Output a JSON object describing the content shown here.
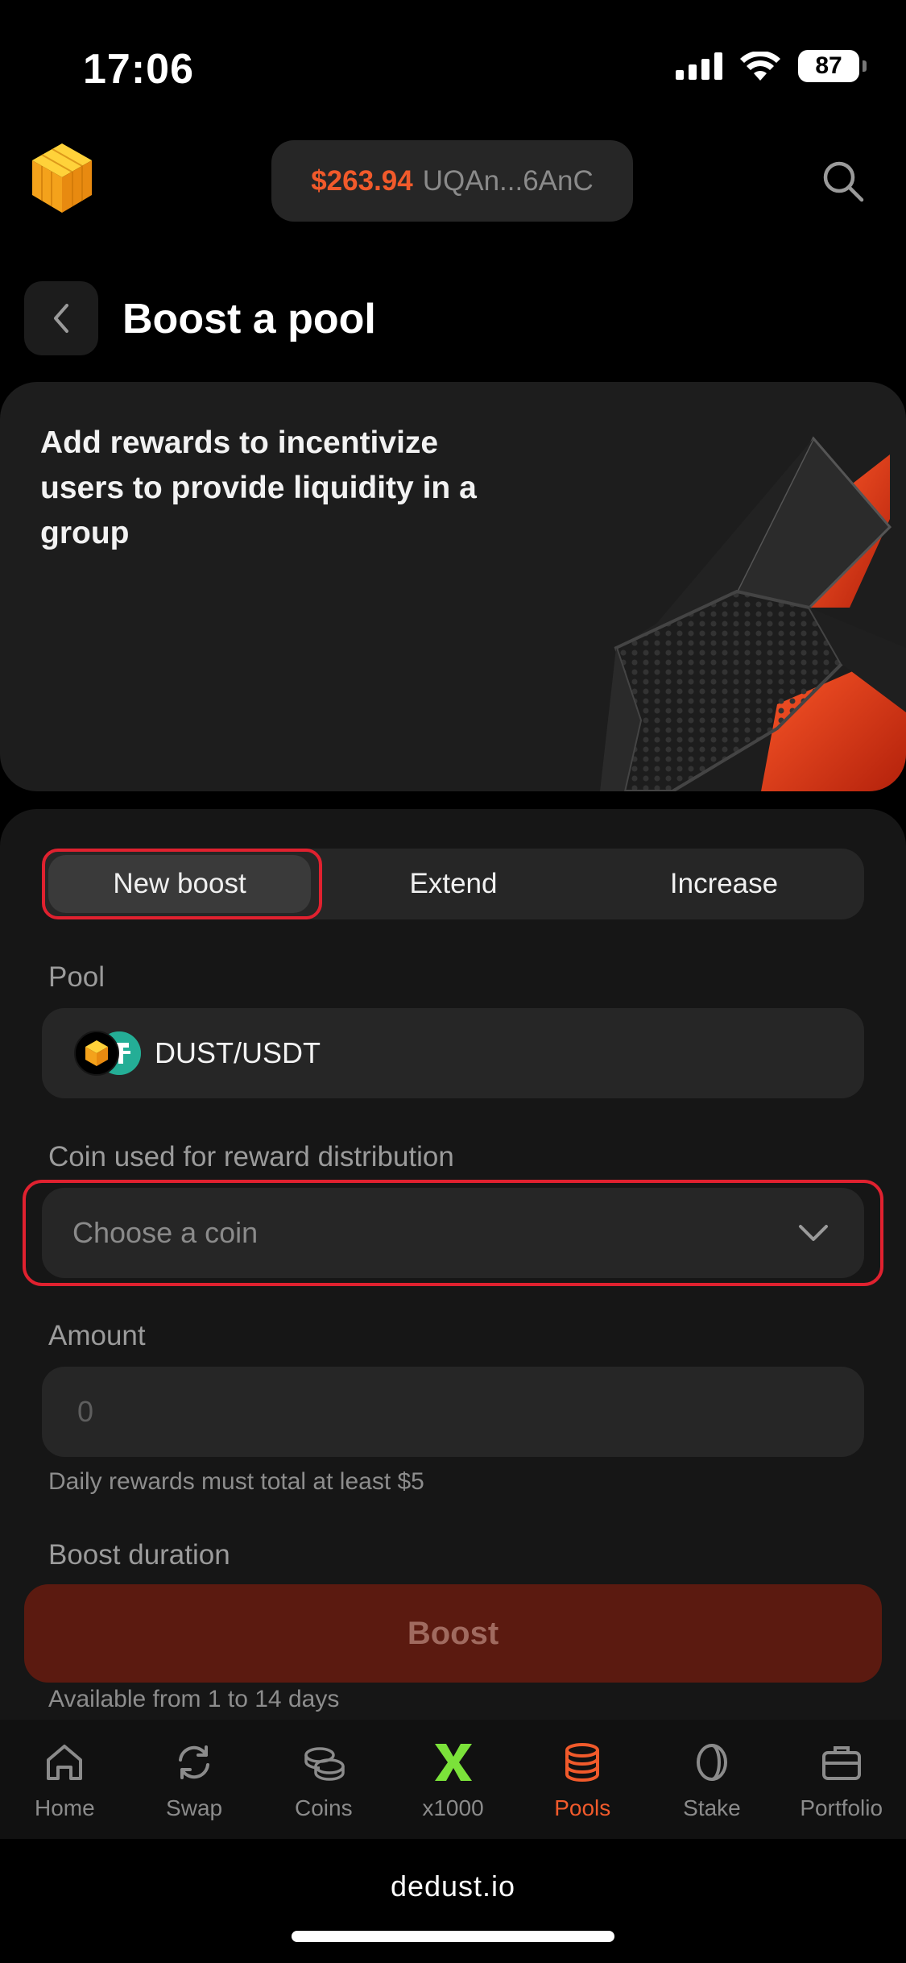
{
  "status_bar": {
    "time": "17:06",
    "battery": "87"
  },
  "header": {
    "balance": "$263.94",
    "address": "UQAn...6AnC"
  },
  "page": {
    "title": "Boost a pool"
  },
  "hero": {
    "text": "Add rewards to incentivize users to provide liquidity in a group"
  },
  "segmented": {
    "items": [
      {
        "label": "New boost",
        "active": true
      },
      {
        "label": "Extend",
        "active": false
      },
      {
        "label": "Increase",
        "active": false
      }
    ]
  },
  "form": {
    "pool_label": "Pool",
    "pool_value": "DUST/USDT",
    "coin_label": "Coin used for reward distribution",
    "coin_placeholder": "Choose a coin",
    "amount_label": "Amount",
    "amount_placeholder": "0",
    "amount_helper": "Daily rewards must total at least $5",
    "duration_label": "Boost duration",
    "duration_helper": "Available from 1 to 14 days",
    "submit_label": "Boost"
  },
  "tabbar": {
    "items": [
      {
        "label": "Home",
        "icon": "home-icon"
      },
      {
        "label": "Swap",
        "icon": "swap-icon"
      },
      {
        "label": "Coins",
        "icon": "coins-icon"
      },
      {
        "label": "x1000",
        "icon": "x1000-icon"
      },
      {
        "label": "Pools",
        "icon": "pools-icon",
        "active": true
      },
      {
        "label": "Stake",
        "icon": "stake-icon"
      },
      {
        "label": "Portfolio",
        "icon": "portfolio-icon"
      }
    ]
  },
  "browser": {
    "url": "dedust.io"
  },
  "colors": {
    "accent": "#f15a2b",
    "highlight": "#e0212f",
    "background": "#000000",
    "card": "#1d1d1d"
  }
}
